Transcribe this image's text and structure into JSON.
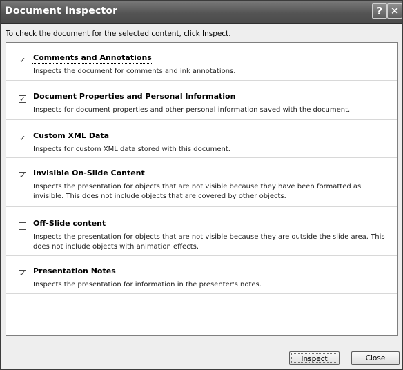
{
  "window": {
    "title": "Document Inspector",
    "help_label": "?",
    "close_label": "✕"
  },
  "instruction": "To check the document for the selected content, click Inspect.",
  "items": [
    {
      "title": "Comments and Annotations",
      "description": "Inspects the document for comments and ink annotations.",
      "checked": true,
      "focused": true
    },
    {
      "title": "Document Properties and Personal Information",
      "description": "Inspects for document properties and other personal information saved with the document.",
      "checked": true,
      "focused": false
    },
    {
      "title": "Custom XML Data",
      "description": "Inspects for custom XML data stored with this document.",
      "checked": true,
      "focused": false
    },
    {
      "title": "Invisible On-Slide Content",
      "description": "Inspects the presentation for objects that are not visible because they have been formatted as invisible. This does not include objects that are covered by other objects.",
      "checked": true,
      "focused": false
    },
    {
      "title": "Off-Slide content",
      "description": "Inspects the presentation for objects that are not visible because they are outside the slide area. This does not include objects with animation effects.",
      "checked": false,
      "focused": false
    },
    {
      "title": "Presentation Notes",
      "description": "Inspects the presentation for information in the presenter's notes.",
      "checked": true,
      "focused": false
    }
  ],
  "buttons": {
    "inspect_label": "Inspect",
    "close_label": "Close"
  }
}
